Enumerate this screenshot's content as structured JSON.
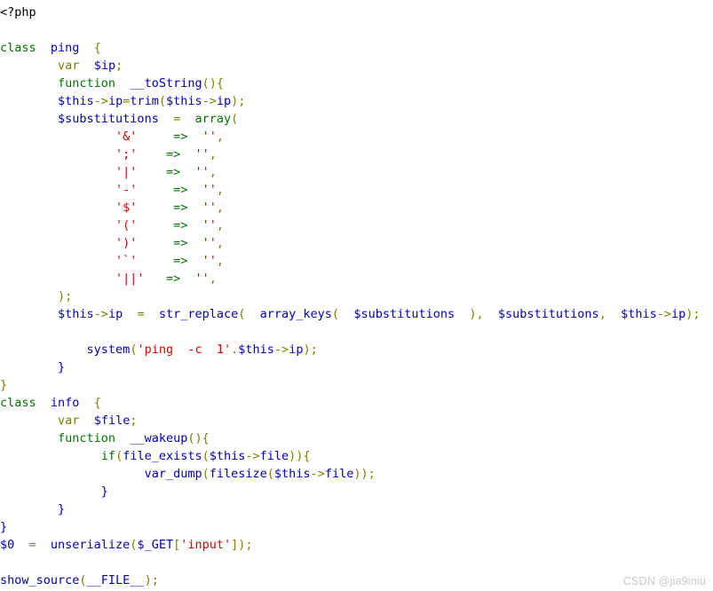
{
  "document": {
    "language": "php",
    "background_color": "#ffffff",
    "renderer": "php-show-source"
  },
  "palette": {
    "default": "#0000bb",
    "keyword": "#007700",
    "string": "#dd0000",
    "punctuation": "#007700",
    "brace": "#808000",
    "comment": "#ff8000",
    "html": "#000000",
    "watermark": "#c9c9c9"
  },
  "watermark": {
    "text": "CSDN @jia9iniu"
  },
  "code": {
    "lines": [
      {
        "n": 1,
        "text": "<?php"
      },
      {
        "n": 2,
        "text": ""
      },
      {
        "n": 3,
        "text": "class  ping  {"
      },
      {
        "n": 4,
        "text": "        var  $ip;"
      },
      {
        "n": 5,
        "text": "        function  __toString(){"
      },
      {
        "n": 6,
        "text": "        $this->ip=trim($this->ip);"
      },
      {
        "n": 7,
        "text": "        $substitutions  =  array("
      },
      {
        "n": 8,
        "text": "                '&'     =>  '',"
      },
      {
        "n": 9,
        "text": "                ';'    =>  '',"
      },
      {
        "n": 10,
        "text": "                '|'    =>  '',"
      },
      {
        "n": 11,
        "text": "                '-'     =>  '',"
      },
      {
        "n": 12,
        "text": "                '$'     =>  '',"
      },
      {
        "n": 13,
        "text": "                '('     =>  '',"
      },
      {
        "n": 14,
        "text": "                ')'     =>  '',"
      },
      {
        "n": 15,
        "text": "                '`'     =>  '',"
      },
      {
        "n": 16,
        "text": "                '||'   =>  '',"
      },
      {
        "n": 17,
        "text": "        );"
      },
      {
        "n": 18,
        "text": "        $this->ip  =  str_replace(  array_keys(  $substitutions  ),  $substitutions,  $this->ip);"
      },
      {
        "n": 19,
        "text": ""
      },
      {
        "n": 20,
        "text": "            system('ping  -c  1'.$this->ip);"
      },
      {
        "n": 21,
        "text": "        }"
      },
      {
        "n": 22,
        "text": "}"
      },
      {
        "n": 23,
        "text": "class  info  {"
      },
      {
        "n": 24,
        "text": "        var  $file;"
      },
      {
        "n": 25,
        "text": "        function  __wakeup(){"
      },
      {
        "n": 26,
        "text": "              if(file_exists($this->file)){"
      },
      {
        "n": 27,
        "text": "                    var_dump(filesize($this->file));"
      },
      {
        "n": 28,
        "text": "              }"
      },
      {
        "n": 29,
        "text": "        }"
      },
      {
        "n": 30,
        "text": "}"
      },
      {
        "n": 31,
        "text": "$0  =  unserialize($_GET['input']);"
      },
      {
        "n": 32,
        "text": ""
      },
      {
        "n": 33,
        "text": "show_source(__FILE__);"
      }
    ],
    "substitution_array": {
      "variable": "$substitutions",
      "keys": [
        "&",
        ";",
        "|",
        "-",
        "$",
        "(",
        ")",
        "`",
        "||"
      ],
      "values": [
        "",
        "",
        "",
        "",
        "",
        "",
        "",
        "",
        ""
      ]
    },
    "classes": [
      {
        "name": "ping",
        "properties": [
          "$ip"
        ],
        "methods": [
          "__toString"
        ],
        "sink": "system('ping -c 1'.$this->ip)"
      },
      {
        "name": "info",
        "properties": [
          "$file"
        ],
        "methods": [
          "__wakeup"
        ],
        "sink": "var_dump(filesize($this->file))"
      }
    ],
    "entrypoint": "$0 = unserialize($_GET['input']);",
    "footer_call": "show_source(__FILE__);"
  },
  "tokens": {
    "line1": [
      [
        "<?php",
        "html"
      ]
    ],
    "line3": [
      [
        "class",
        "keyword"
      ],
      [
        "  ",
        "default"
      ],
      [
        "ping",
        "default"
      ],
      [
        "  ",
        "default"
      ],
      [
        "{",
        "brace"
      ]
    ],
    "line4": [
      [
        "        ",
        "default"
      ],
      [
        "var",
        "brace"
      ],
      [
        "  ",
        "default"
      ],
      [
        "$ip",
        "default"
      ],
      [
        ";",
        "brace"
      ]
    ],
    "line5": [
      [
        "        ",
        "default"
      ],
      [
        "function",
        "keyword"
      ],
      [
        "  ",
        "default"
      ],
      [
        "__toString",
        "default"
      ],
      [
        "(){",
        "brace"
      ]
    ],
    "line6": [
      [
        "        ",
        "default"
      ],
      [
        "$this",
        "default"
      ],
      [
        "->",
        "brace"
      ],
      [
        "ip",
        "default"
      ],
      [
        "=",
        "brace"
      ],
      [
        "trim",
        "default"
      ],
      [
        "(",
        "brace"
      ],
      [
        "$this",
        "default"
      ],
      [
        "->",
        "brace"
      ],
      [
        "ip",
        "default"
      ],
      [
        ");",
        "brace"
      ]
    ],
    "line7": [
      [
        "        ",
        "default"
      ],
      [
        "$substitutions",
        "default"
      ],
      [
        "  ",
        "default"
      ],
      [
        "=",
        "brace"
      ],
      [
        "  ",
        "default"
      ],
      [
        "array",
        "keyword"
      ],
      [
        "(",
        "brace"
      ]
    ],
    "line17": [
      [
        "        ",
        "default"
      ],
      [
        ");",
        "brace"
      ]
    ],
    "line18": [
      [
        "        ",
        "default"
      ],
      [
        "$this",
        "default"
      ],
      [
        "->",
        "brace"
      ],
      [
        "ip",
        "default"
      ],
      [
        "  =  ",
        "brace"
      ],
      [
        "str_replace",
        "default"
      ],
      [
        "(  ",
        "brace"
      ],
      [
        "array_keys",
        "default"
      ],
      [
        "(  ",
        "brace"
      ],
      [
        "$substitutions",
        "default"
      ],
      [
        "  ),  ",
        "brace"
      ],
      [
        "$substitutions",
        "default"
      ],
      [
        ",  ",
        "brace"
      ],
      [
        "$this",
        "default"
      ],
      [
        "->",
        "brace"
      ],
      [
        "ip",
        "default"
      ],
      [
        ");",
        "brace"
      ]
    ],
    "line20": [
      [
        "            ",
        "default"
      ],
      [
        "system",
        "default"
      ],
      [
        "(",
        "brace"
      ],
      [
        "'ping  -c  1'",
        "string"
      ],
      [
        ".",
        "brace"
      ],
      [
        "$this",
        "default"
      ],
      [
        "->",
        "brace"
      ],
      [
        "ip",
        "default"
      ],
      [
        ");",
        "brace"
      ]
    ],
    "line22": [
      [
        "}",
        "brace"
      ]
    ],
    "line23": [
      [
        "class",
        "keyword"
      ],
      [
        "  ",
        "default"
      ],
      [
        "info",
        "default"
      ],
      [
        "  ",
        "default"
      ],
      [
        "{",
        "brace"
      ]
    ],
    "line24": [
      [
        "        ",
        "default"
      ],
      [
        "var",
        "brace"
      ],
      [
        "  ",
        "default"
      ],
      [
        "$file",
        "default"
      ],
      [
        ";",
        "brace"
      ]
    ],
    "line25": [
      [
        "        ",
        "default"
      ],
      [
        "function",
        "keyword"
      ],
      [
        "  ",
        "default"
      ],
      [
        "__wakeup",
        "default"
      ],
      [
        "(){",
        "brace"
      ]
    ],
    "line26": [
      [
        "              ",
        "default"
      ],
      [
        "if",
        "keyword"
      ],
      [
        "(",
        "brace"
      ],
      [
        "file_exists",
        "default"
      ],
      [
        "(",
        "brace"
      ],
      [
        "$this",
        "default"
      ],
      [
        "->",
        "brace"
      ],
      [
        "file",
        "default"
      ],
      [
        ")){",
        "brace"
      ]
    ],
    "line27": [
      [
        "                    ",
        "default"
      ],
      [
        "var_dump",
        "default"
      ],
      [
        "(",
        "brace"
      ],
      [
        "filesize",
        "default"
      ],
      [
        "(",
        "brace"
      ],
      [
        "$this",
        "default"
      ],
      [
        "->",
        "brace"
      ],
      [
        "file",
        "default"
      ],
      [
        "));",
        "brace"
      ]
    ],
    "line31": [
      [
        "$0",
        "default"
      ],
      [
        "  =  ",
        "brace"
      ],
      [
        "unserialize",
        "default"
      ],
      [
        "(",
        "brace"
      ],
      [
        "$_GET",
        "default"
      ],
      [
        "[",
        "brace"
      ],
      [
        "'input'",
        "string"
      ],
      [
        "]);",
        "brace"
      ]
    ],
    "line33": [
      [
        "show_source",
        "default"
      ],
      [
        "(",
        "brace"
      ],
      [
        "__FILE__",
        "default"
      ],
      [
        ");",
        "brace"
      ]
    ]
  }
}
